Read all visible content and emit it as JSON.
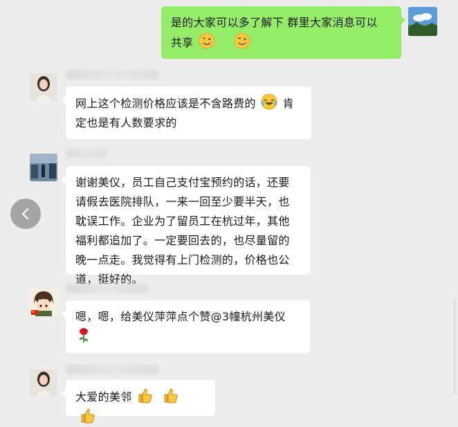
{
  "conversation": {
    "messages": [
      {
        "side": "right",
        "lines": [
          "是的大家可以多了解下  群里大家消息可以",
          "共享"
        ],
        "emoji_tail": [
          "wink-emoji",
          "wink-emoji"
        ]
      },
      {
        "side": "left",
        "lines": [
          "网上这个检测价格应该是不含路费的",
          "定也是有人数要求的"
        ],
        "inline_emoji": "laugh-cry-emoji",
        "after_emoji": "肯"
      },
      {
        "side": "left",
        "lines": [
          "谢谢美仪，员工自己支付宝预约的话，还要",
          "请假去医院排队，一来一回至少要半天，也",
          "耽误工作。企业为了留员工在杭过年，其他",
          "福利都追加了。一定要回去的，也尽量留的",
          "晚一点走。我觉得有上门检测的，价格也公",
          "道，挺好的。"
        ]
      },
      {
        "side": "left",
        "lines": [
          "嗯，嗯，给美仪萍萍点个赞@3幢杭州美仪"
        ],
        "emoji_tail": [
          "rose-emoji"
        ]
      },
      {
        "side": "left",
        "lines": [
          "大爱的美邻"
        ],
        "emoji_tail": [
          "thumbs-up-emoji",
          "thumbs-up-emoji",
          "thumbs-up-emoji"
        ]
      }
    ]
  },
  "colors": {
    "background": "#ededed",
    "bubble_self": "#95ec69",
    "bubble_other": "#ffffff"
  },
  "icons": {
    "back": "chevron-left-icon"
  }
}
